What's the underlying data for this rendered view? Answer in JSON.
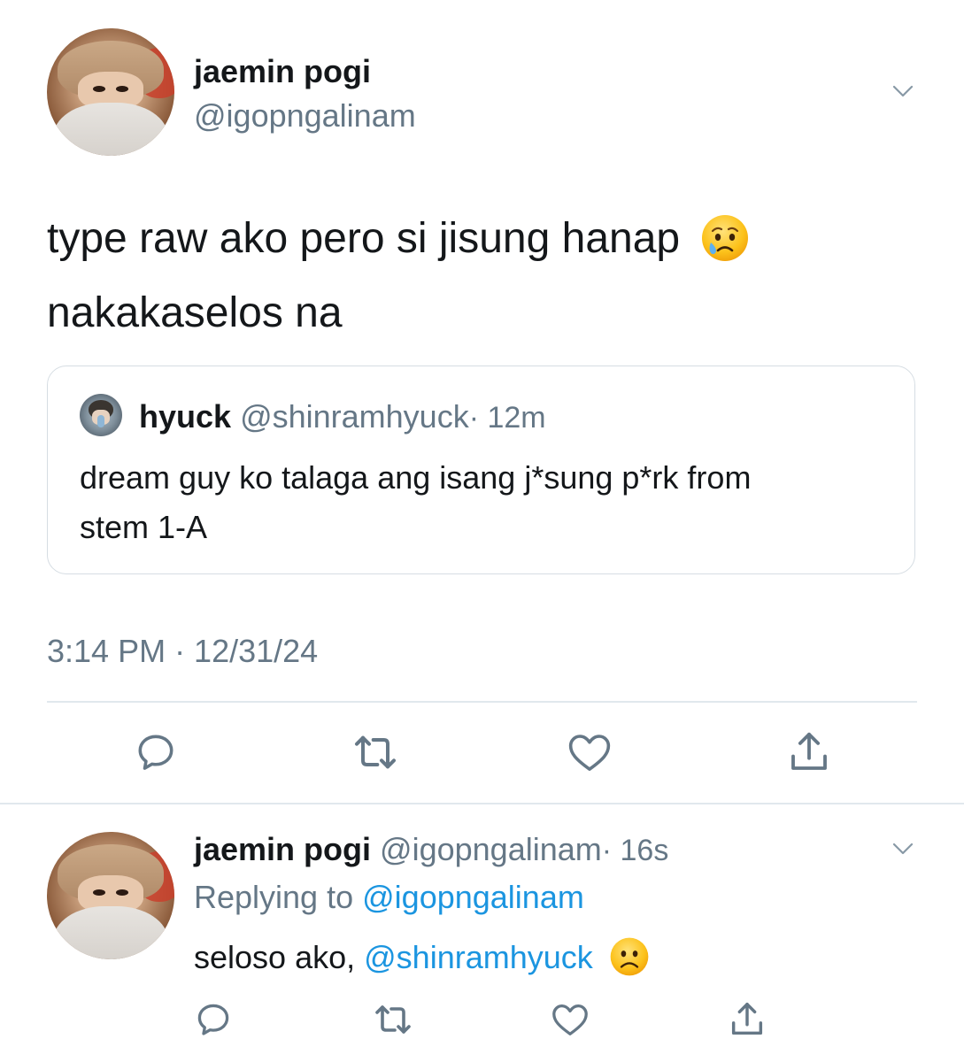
{
  "main_tweet": {
    "display_name": "jaemin pogi",
    "handle": "@igopngalinam",
    "text_line1": "type raw ako pero si jisung hanap",
    "text_line2": "nakakaselos na",
    "emoji": "crying-face",
    "timestamp": "3:14 PM · 12/31/24"
  },
  "quoted_tweet": {
    "display_name": "hyuck",
    "handle": "@shinramhyuck",
    "time": "· 12m",
    "text_line1": "dream guy ko talaga ang isang j*sung p*rk from",
    "text_line2": "stem 1-A"
  },
  "reply_tweet": {
    "display_name": "jaemin pogi",
    "handle": "@igopngalinam",
    "time": "· 16s",
    "replying_prefix": "Replying to",
    "replying_to": "@igopngalinam",
    "text_prefix": "seloso ako,",
    "mention": "@shinramhyuck",
    "emoji": "frowning-face"
  },
  "icons": {
    "reply": "reply-icon",
    "retweet": "retweet-icon",
    "like": "heart-icon",
    "share": "share-icon",
    "more": "chevron-down-icon"
  },
  "colors": {
    "text": "#14171a",
    "secondary": "#657786",
    "link": "#1b95e0",
    "border": "#e1e8ed"
  }
}
